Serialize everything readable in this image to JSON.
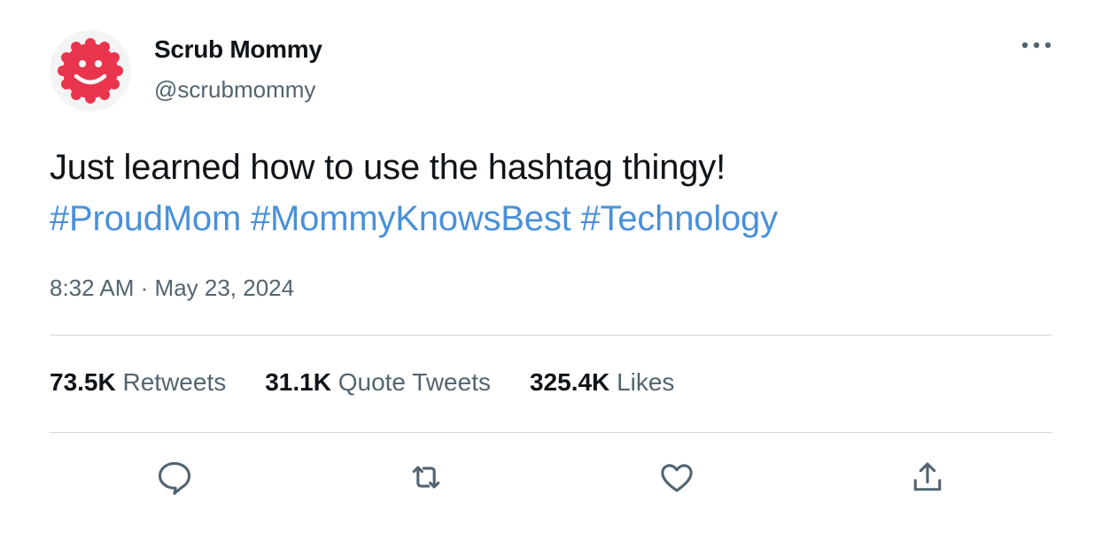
{
  "author": {
    "name": "Scrub Mommy",
    "handle": "@scrubmommy"
  },
  "tweet": {
    "text": "Just learned how to use the hashtag thingy!",
    "hashtags": [
      "#ProudMom",
      "#MommyKnowsBest",
      "#Technology"
    ],
    "time": "8:32 AM",
    "separator": "·",
    "date": "May 23, 2024"
  },
  "stats": [
    {
      "count": "73.5K",
      "label": "Retweets"
    },
    {
      "count": "31.1K",
      "label": "Quote Tweets"
    },
    {
      "count": "325.4K",
      "label": "Likes"
    }
  ],
  "actions": [
    "reply-icon",
    "retweet-icon",
    "like-icon",
    "share-icon"
  ],
  "colors": {
    "hashtag": "#4a90d9",
    "secondary_text": "#536471",
    "primary_text": "#0f1419",
    "divider": "#cfd9de",
    "avatar_sponge": "#e8354d"
  }
}
